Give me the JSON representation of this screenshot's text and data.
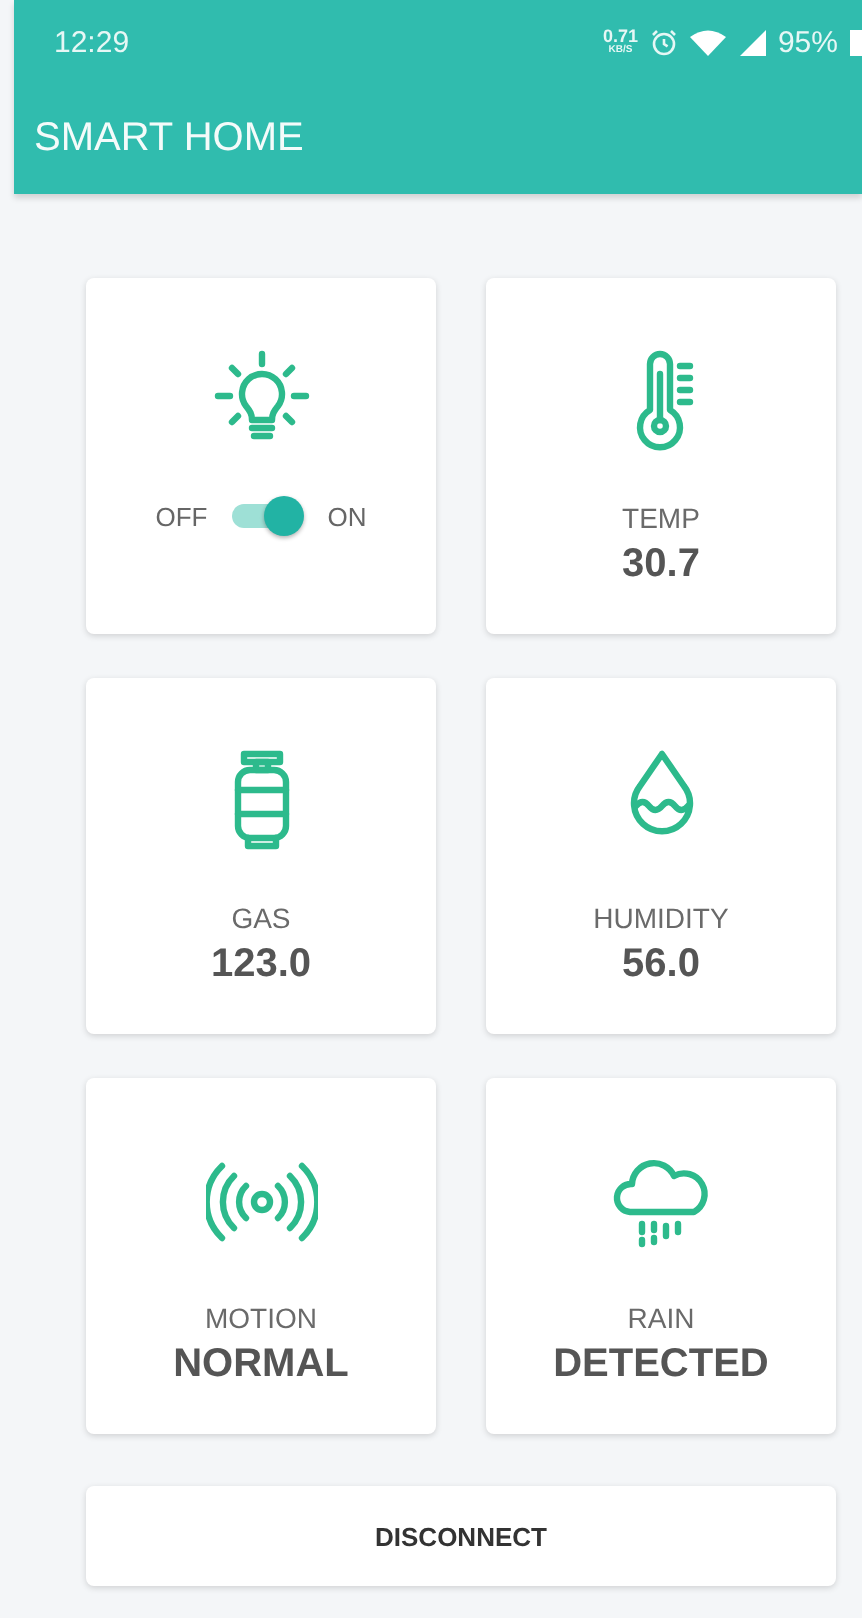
{
  "status_bar": {
    "time": "12:29",
    "speed": "0.71",
    "speed_unit": "KB/S",
    "battery": "95%"
  },
  "app_bar": {
    "title": "SMART HOME"
  },
  "cards": [
    {
      "kind": "switch",
      "off_label": "OFF",
      "on_label": "ON",
      "on": true
    },
    {
      "kind": "reading",
      "label": "TEMP",
      "value": "30.7"
    },
    {
      "kind": "reading",
      "label": "GAS",
      "value": "123.0"
    },
    {
      "kind": "reading",
      "label": "HUMIDITY",
      "value": "56.0"
    },
    {
      "kind": "reading",
      "label": "MOTION",
      "value": "NORMAL"
    },
    {
      "kind": "reading",
      "label": "RAIN",
      "value": "DETECTED"
    }
  ],
  "button": {
    "label": "DISCONNECT"
  }
}
